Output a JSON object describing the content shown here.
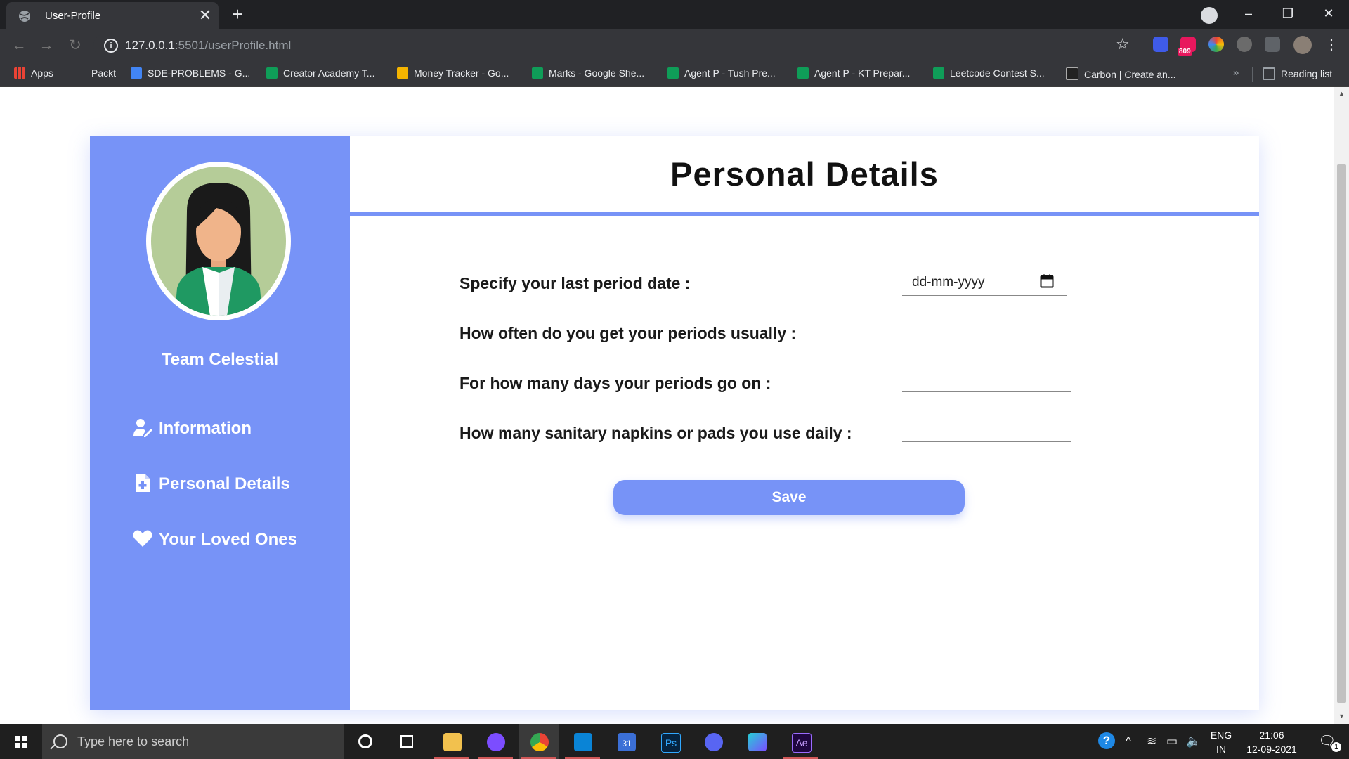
{
  "browser": {
    "tab_title": "User-Profile",
    "tab_close": "✕",
    "new_tab": "+",
    "url_host": "127.0.0.1",
    "url_rest": ":5501/userProfile.html",
    "window_controls": {
      "minimize": "–",
      "restore": "❐",
      "close": "✕"
    },
    "bookmarks": [
      {
        "label": "Apps",
        "icon": "apps-grid-icon",
        "color": "#ea4335"
      },
      {
        "label": "Packt",
        "icon": "none",
        "color": ""
      },
      {
        "label": "SDE-PROBLEMS - G...",
        "icon": "google-docs-icon",
        "color": "#4285f4"
      },
      {
        "label": "Creator Academy T...",
        "icon": "google-sheets-icon",
        "color": "#0f9d58"
      },
      {
        "label": "Money Tracker - Go...",
        "icon": "google-slides-icon",
        "color": "#f4b400"
      },
      {
        "label": "Marks - Google She...",
        "icon": "google-sheets-icon",
        "color": "#0f9d58"
      },
      {
        "label": "Agent P - Tush Pre...",
        "icon": "google-sheets-icon",
        "color": "#0f9d58"
      },
      {
        "label": "Agent P - KT Prepar...",
        "icon": "google-sheets-icon",
        "color": "#0f9d58"
      },
      {
        "label": "Leetcode Contest S...",
        "icon": "google-sheets-icon",
        "color": "#0f9d58"
      },
      {
        "label": "Carbon | Create an...",
        "icon": "carbon-icon",
        "color": "#222222"
      }
    ],
    "bookmarks_more": "»",
    "reading_list": "Reading list",
    "extension_badge": "809"
  },
  "sidebar": {
    "team_name": "Team Celestial",
    "items": [
      {
        "label": "Information",
        "icon": "user-edit-icon"
      },
      {
        "label": "Personal Details",
        "icon": "file-medical-icon"
      },
      {
        "label": "Your Loved Ones",
        "icon": "heart-icon"
      }
    ]
  },
  "main": {
    "title": "Personal Details",
    "questions": [
      {
        "label": "Specify your last period date :",
        "placeholder": "dd-mm-yyyy",
        "type": "date"
      },
      {
        "label": "How often do you get your periods usually :",
        "value": "",
        "type": "text"
      },
      {
        "label": "For how many days your periods go on :",
        "value": "",
        "type": "text"
      },
      {
        "label": "How many sanitary napkins or pads you use daily :",
        "value": "",
        "type": "text"
      }
    ],
    "save_label": "Save"
  },
  "colors": {
    "accent": "#7793f7"
  },
  "taskbar": {
    "search_placeholder": "Type here to search",
    "lang_top": "ENG",
    "lang_bottom": "IN",
    "time": "21:06",
    "date": "12-09-2021",
    "notification_count": "1",
    "calendar_day": "31",
    "ps_label": "Ps",
    "ae_label": "Ae"
  }
}
